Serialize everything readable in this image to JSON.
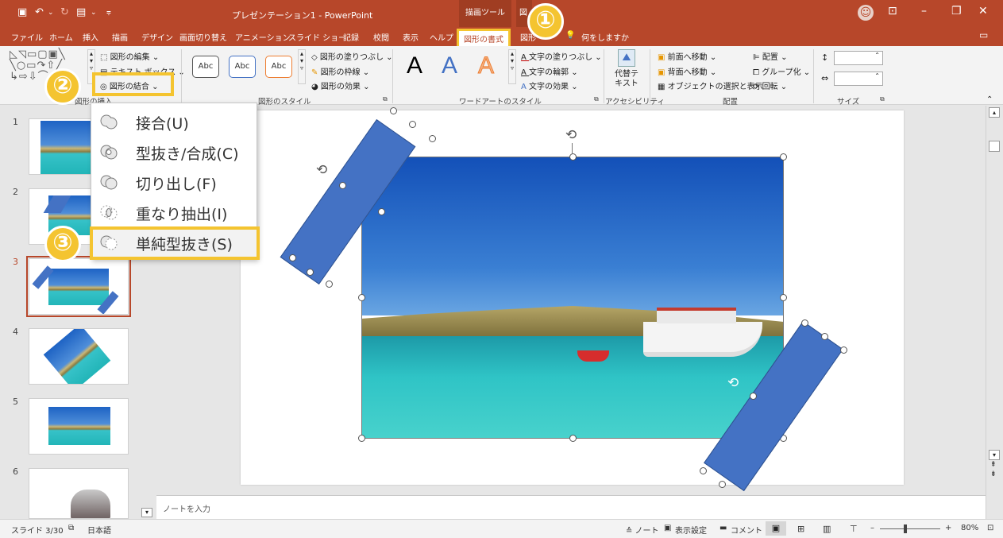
{
  "titlebar": {
    "title": "プレゼンテーション1  -  PowerPoint",
    "context_tab_group": "描画ツール",
    "context_tab_partial": "図"
  },
  "tabs": [
    "ファイル",
    "ホーム",
    "挿入",
    "描画",
    "デザイン",
    "画面切り替え",
    "アニメーション",
    "スライド ショー",
    "記録",
    "校閲",
    "表示",
    "ヘルプ",
    "図形の書式",
    "図形",
    "何をしますか"
  ],
  "ribbon": {
    "insert_shapes": {
      "edit_shape": "図形の編集 ⌄",
      "text_box": "テキスト ボックス ⌄",
      "merge_shapes": "図形の結合 ⌄",
      "group_label": "図形の挿入"
    },
    "shape_styles": {
      "sample": "Abc",
      "fill": "図形の塗りつぶし ⌄",
      "outline": "図形の枠線 ⌄",
      "effects": "図形の効果 ⌄",
      "group_label": "図形のスタイル"
    },
    "wordart": {
      "letter": "A",
      "text_fill": "文字の塗りつぶし ⌄",
      "text_outline": "文字の輪郭 ⌄",
      "text_effects": "文字の効果 ⌄",
      "group_label": "ワードアートのスタイル"
    },
    "accessibility": {
      "alt_text": "代替テキスト",
      "group_label": "アクセシビリティ"
    },
    "arrange": {
      "bring_forward": "前面へ移動 ⌄",
      "send_backward": "背面へ移動 ⌄",
      "selection_pane": "オブジェクトの選択と表示",
      "align": "配置 ⌄",
      "group": "グループ化 ⌄",
      "rotate": "回転 ⌄",
      "group_label": "配置"
    },
    "size": {
      "group_label": "サイズ"
    }
  },
  "merge_menu": {
    "items": [
      {
        "label": "接合(U)"
      },
      {
        "label": "型抜き/合成(C)"
      },
      {
        "label": "切り出し(F)"
      },
      {
        "label": "重なり抽出(I)"
      },
      {
        "label": "単純型抜き(S)"
      }
    ]
  },
  "badges": {
    "one": "①",
    "two": "②",
    "three": "③"
  },
  "thumbnails": [
    "1",
    "2",
    "3",
    "4",
    "5",
    "6"
  ],
  "notes_placeholder": "ノートを入力",
  "statusbar": {
    "slide_info": "スライド 3/30",
    "language": "日本語",
    "notes": "≙ ノート",
    "display_settings": "表示設定",
    "comments": "コメント",
    "zoom": "80%"
  },
  "colors": {
    "accent": "#b7472a",
    "highlight": "#f4c430",
    "shape_blue": "#4472c4"
  }
}
